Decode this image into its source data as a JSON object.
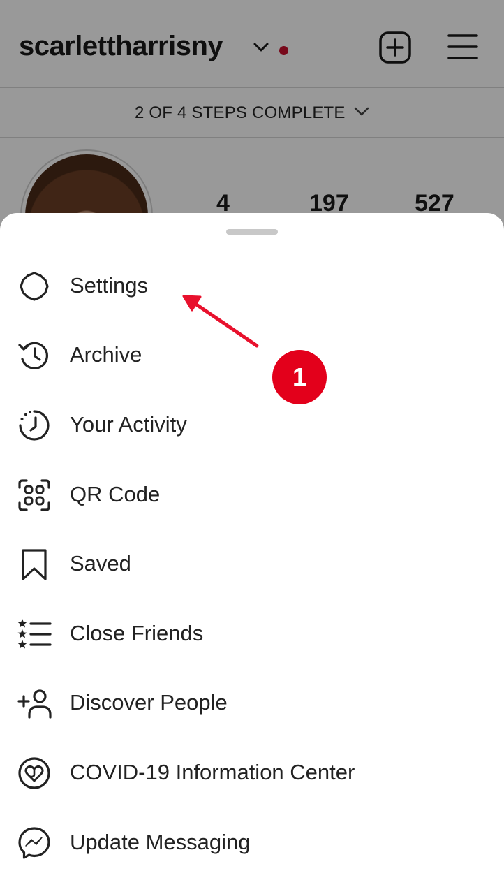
{
  "profile": {
    "username": "scarlettharrisny",
    "steps_banner": "2 OF 4 STEPS COMPLETE",
    "stats": [
      "4",
      "197",
      "527"
    ]
  },
  "icons": {
    "username_chevron": "chevron-down-icon",
    "new_post": "plus-square-icon",
    "menu": "hamburger-menu-icon",
    "steps_chevron": "chevron-down-icon"
  },
  "menu": {
    "items": [
      {
        "label": "Settings",
        "icon": "gear-icon"
      },
      {
        "label": "Archive",
        "icon": "archive-clock-icon"
      },
      {
        "label": "Your Activity",
        "icon": "activity-clock-icon"
      },
      {
        "label": "QR Code",
        "icon": "qr-code-icon"
      },
      {
        "label": "Saved",
        "icon": "bookmark-icon"
      },
      {
        "label": "Close Friends",
        "icon": "close-friends-list-icon"
      },
      {
        "label": "Discover People",
        "icon": "add-person-icon"
      },
      {
        "label": "COVID-19 Information Center",
        "icon": "heart-in-circle-icon"
      },
      {
        "label": "Update Messaging",
        "icon": "messenger-icon"
      }
    ]
  },
  "annotation": {
    "step_number": "1",
    "badge_color": "#e3001b",
    "arrow_color": "#e8112d"
  },
  "colors": {
    "notification_dot": "#c8102e",
    "overlay": "rgba(0,0,0,0.40)",
    "sheet_background": "#ffffff"
  }
}
